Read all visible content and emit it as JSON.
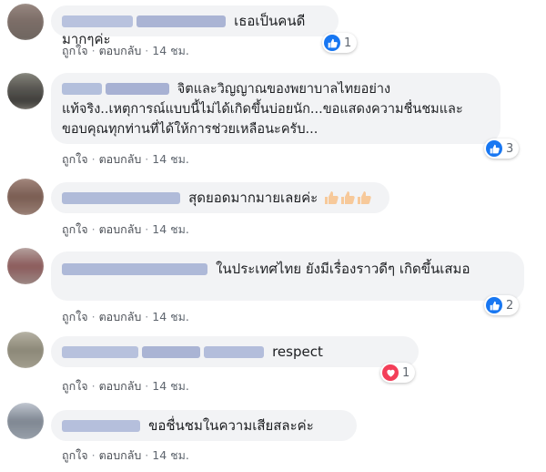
{
  "comments": [
    {
      "text": "เธอเป็นคนดีมากๆค่ะ",
      "reactions": {
        "type": "like",
        "count": "1"
      },
      "actions": {
        "like": "ถูกใจ",
        "reply": "ตอบกลับ",
        "time": "14 ชม."
      },
      "avatar_color": "#8f7f78"
    },
    {
      "text": "จิตและวิญญาณของพยาบาลไทยอย่างแท้จริง..เหตุการณ์แบบนี้ไม่ได้เกิดขึ้นบ่อยนัก...ขอแสดงความชื่นชมและขอบคุณทุกท่านที่ได้ให้การช่วยเหลือนะครับ...",
      "reactions": {
        "type": "like",
        "count": "3"
      },
      "actions": {
        "like": "ถูกใจ",
        "reply": "ตอบกลับ",
        "time": "14 ชม."
      },
      "avatar_color": "#6e6a63"
    },
    {
      "text": "สุดยอดมากมายเลยค่ะ",
      "emojis": [
        "thumbs-up",
        "thumbs-up",
        "thumbs-up"
      ],
      "actions": {
        "like": "ถูกใจ",
        "reply": "ตอบกลับ",
        "time": "14 ชม."
      },
      "avatar_color": "#8a6f63"
    },
    {
      "text": "ในประเทศไทย ยังมีเรื่องราวดีๆ เกิดขึ้นเสมอ",
      "reactions": {
        "type": "like",
        "count": "2"
      },
      "actions": {
        "like": "ถูกใจ",
        "reply": "ตอบกลับ",
        "time": "14 ชม."
      },
      "avatar_color": "#9a7a7a"
    },
    {
      "text": "respect",
      "reactions": {
        "type": "love",
        "count": "1"
      },
      "actions": {
        "like": "ถูกใจ",
        "reply": "ตอบกลับ",
        "time": "14 ชม."
      },
      "avatar_color": "#8c8a7e"
    },
    {
      "text": "ขอชื่นชมในความเสียสละค่ะ",
      "actions": {
        "like": "ถูกใจ",
        "reply": "ตอบกลับ",
        "time": "14 ชม."
      },
      "avatar_color": "#8a9099"
    }
  ],
  "colors": {
    "bubble": "#f2f3f5",
    "like_blue": "#1877f2",
    "love_red": "#f33e58",
    "name_blur": "#aab4d4",
    "action_text": "#4b4f56"
  },
  "icons": {
    "like": "thumbs-up-icon",
    "love": "heart-icon"
  }
}
